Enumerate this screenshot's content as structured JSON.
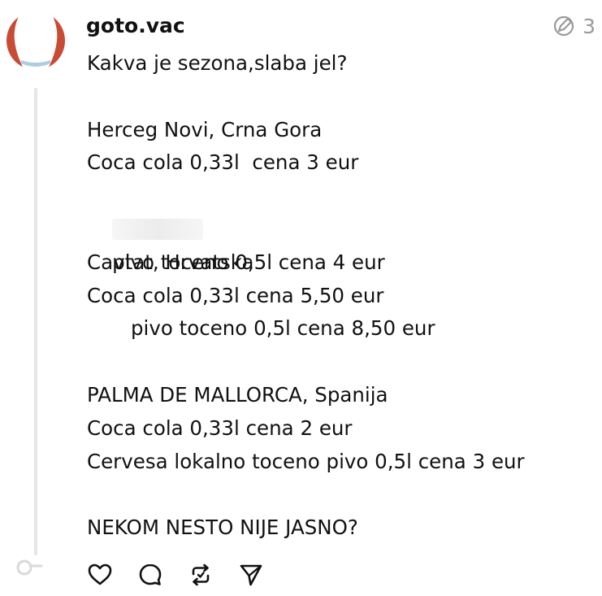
{
  "post": {
    "username": "goto.vac",
    "reply_count": "3",
    "lines": {
      "l1": "Kakva je sezona,slaba jel?",
      "l2": "",
      "l3": "Herceg Novi, Crna Gora",
      "l4": "Coca cola 0,33l  cena 3 eur",
      "l5": "pivo toceno 0,5l cena 4 eur",
      "l6": "",
      "l7": "Cavtat, Hrvatska",
      "l8": "Coca cola 0,33l cena 5,50 eur",
      "l9": "pivo toceno 0,5l cena 8,50 eur",
      "l10": "",
      "l11": "PALMA DE MALLORCA, Spanija",
      "l12": "Coca cola 0,33l cena 2 eur",
      "l13": "Cervesa lokalno toceno pivo 0,5l cena 3 eur",
      "l14": "",
      "l15": "NEKOM NESTO NIJE JASNO?"
    }
  },
  "icons": {
    "avatar": "avatar-image",
    "meta": "edit-reply-count-icon",
    "like": "heart-icon",
    "comment": "comment-icon",
    "repost": "repost-icon",
    "share": "send-icon"
  },
  "colors": {
    "text": "#111111",
    "muted": "#9a9a9a",
    "thread": "#e6e6e6",
    "avatar_red": "#c94b36"
  }
}
